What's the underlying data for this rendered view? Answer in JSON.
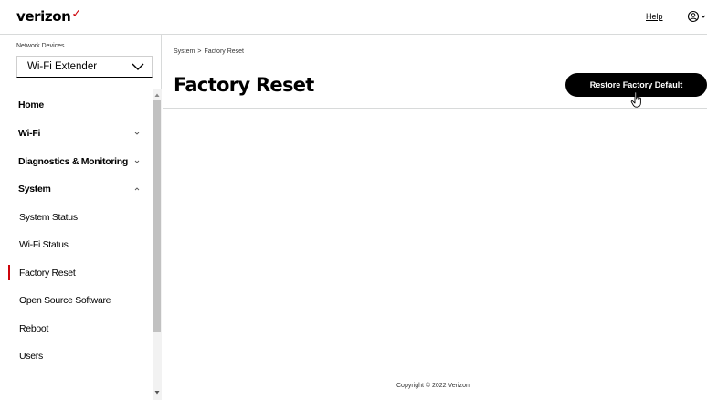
{
  "header": {
    "logo_text": "verizon",
    "logo_mark": "✓",
    "help_label": "Help",
    "user_icon": "user-icon"
  },
  "sidebar": {
    "network_devices_label": "Network Devices",
    "device_select": {
      "value": "Wi-Fi Extender"
    },
    "items": [
      {
        "label": "Home",
        "level": "top",
        "expandable": false
      },
      {
        "label": "Wi-Fi",
        "level": "top",
        "expandable": true,
        "expanded": false
      },
      {
        "label": "Diagnostics & Monitoring",
        "level": "top",
        "expandable": true,
        "expanded": false
      },
      {
        "label": "System",
        "level": "top",
        "expandable": true,
        "expanded": true
      },
      {
        "label": "System Status",
        "level": "sub"
      },
      {
        "label": "Wi-Fi Status",
        "level": "sub"
      },
      {
        "label": "Factory Reset",
        "level": "sub",
        "active": true
      },
      {
        "label": "Open Source Software",
        "level": "sub"
      },
      {
        "label": "Reboot",
        "level": "sub"
      },
      {
        "label": "Users",
        "level": "sub"
      }
    ]
  },
  "breadcrumb": {
    "parent": "System",
    "separator": ">",
    "current": "Factory Reset"
  },
  "main": {
    "title": "Factory Reset",
    "restore_button_label": "Restore Factory Default"
  },
  "footer": {
    "copyright": "Copyright © 2022 Verizon"
  },
  "colors": {
    "accent": "#cd040b",
    "button_bg": "#000000",
    "divider": "#d8dada"
  }
}
